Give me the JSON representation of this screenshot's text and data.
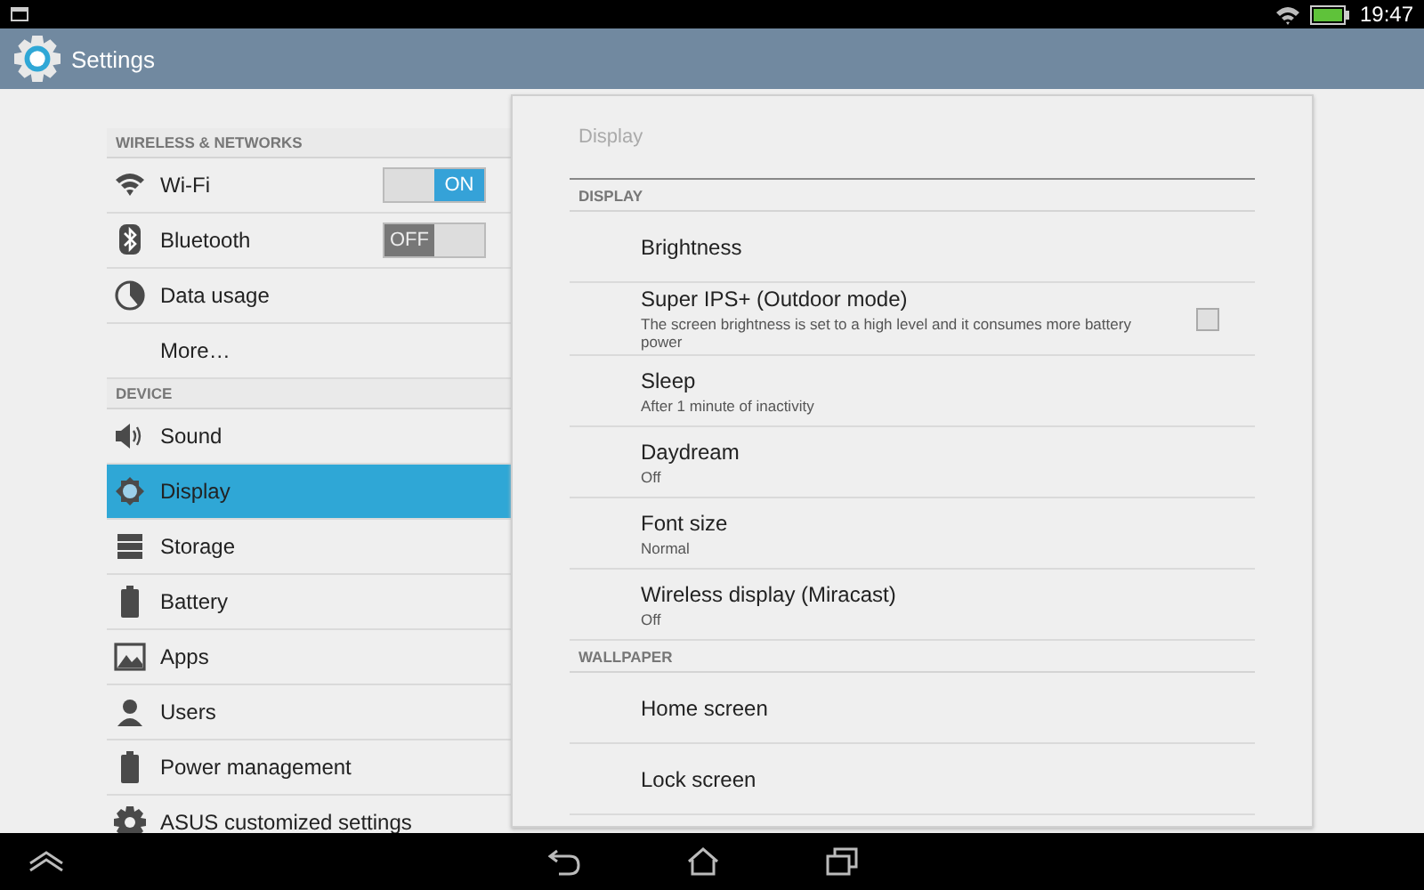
{
  "status_bar": {
    "time": "19:47"
  },
  "action_bar": {
    "title": "Settings"
  },
  "sidebar": {
    "sections": [
      {
        "header": "WIRELESS & NETWORKS",
        "items": [
          {
            "label": "Wi-Fi",
            "selected": false,
            "switch": {
              "label": "ON",
              "on": true
            }
          },
          {
            "label": "Bluetooth",
            "selected": false,
            "switch": {
              "label": "OFF",
              "on": false
            }
          },
          {
            "label": "Data usage",
            "selected": false
          },
          {
            "label": "More…",
            "selected": false
          }
        ]
      },
      {
        "header": "DEVICE",
        "items": [
          {
            "label": "Sound",
            "selected": false
          },
          {
            "label": "Display",
            "selected": true
          },
          {
            "label": "Storage",
            "selected": false
          },
          {
            "label": "Battery",
            "selected": false
          },
          {
            "label": "Apps",
            "selected": false
          },
          {
            "label": "Users",
            "selected": false
          },
          {
            "label": "Power management",
            "selected": false
          },
          {
            "label": "ASUS customized settings",
            "selected": false
          }
        ]
      }
    ]
  },
  "panel": {
    "title": "Display",
    "sections": [
      {
        "header": "DISPLAY",
        "items": [
          {
            "title": "Brightness"
          },
          {
            "title": "Super IPS+ (Outdoor mode)",
            "summary": "The screen brightness is set to a high level and it consumes more battery power",
            "checked": false
          },
          {
            "title": "Sleep",
            "summary": "After 1 minute of inactivity"
          },
          {
            "title": "Daydream",
            "summary": "Off"
          },
          {
            "title": "Font size",
            "summary": "Normal"
          },
          {
            "title": "Wireless display (Miracast)",
            "summary": "Off"
          }
        ]
      },
      {
        "header": "WALLPAPER",
        "items": [
          {
            "title": "Home screen"
          },
          {
            "title": "Lock screen"
          }
        ]
      }
    ]
  }
}
